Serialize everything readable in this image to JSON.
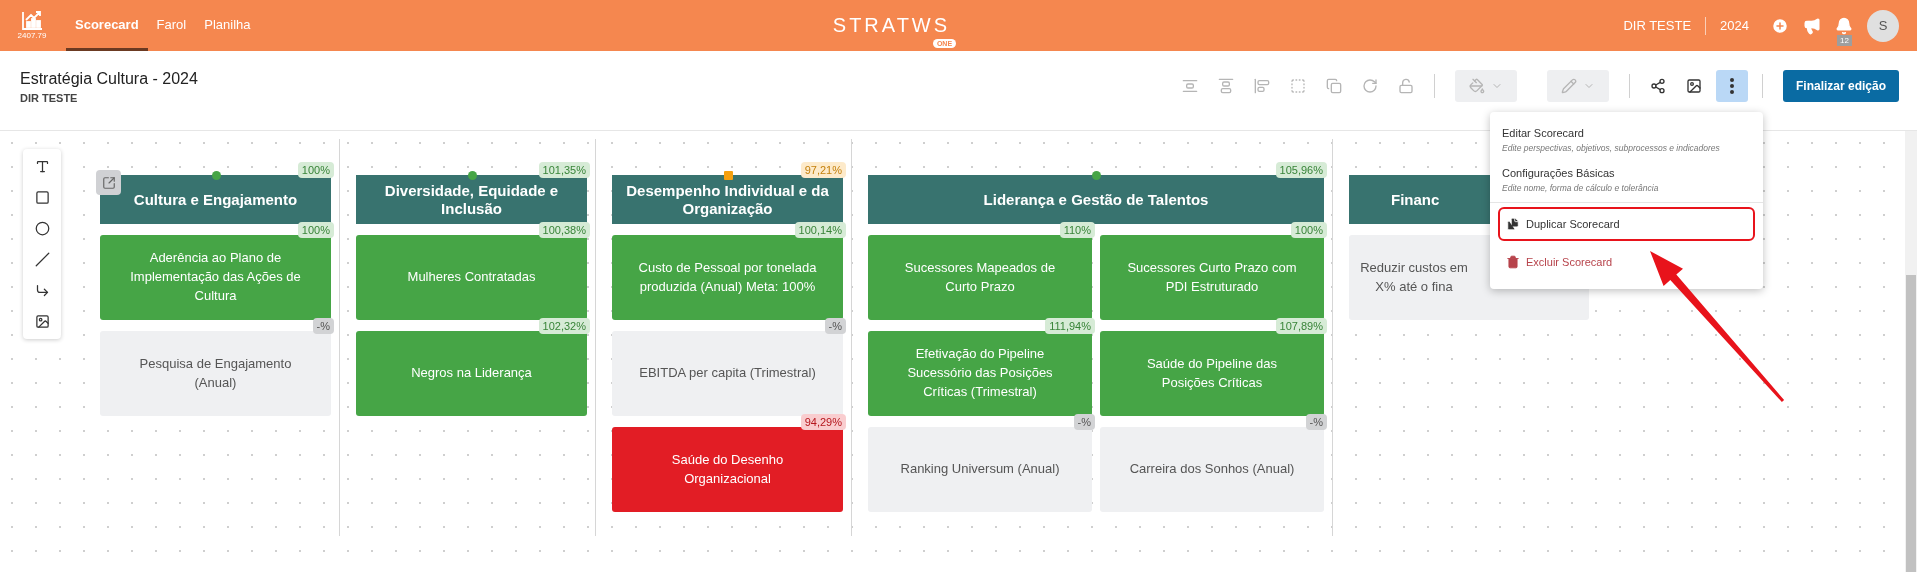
{
  "topbar": {
    "version": "2407.79",
    "tabs": [
      {
        "label": "Scorecard",
        "selected": true
      },
      {
        "label": "Farol",
        "selected": false
      },
      {
        "label": "Planilha",
        "selected": false
      }
    ],
    "logo": "STRATWS",
    "logo_badge": "ONE",
    "unit": "DIR TESTE",
    "year": "2024",
    "notifications": "12",
    "avatar": "S"
  },
  "page": {
    "title": "Estratégia Cultura - 2024",
    "subtitle": "DIR TESTE",
    "align_tools": {
      "disabled": true
    },
    "more_button": {
      "selected": true
    },
    "finish_button": "Finalizar edição"
  },
  "menu": {
    "items": [
      {
        "kind": "option",
        "label": "Editar Scorecard",
        "description": "Edite perspectivas, objetivos, subprocessos e indicadores",
        "highlighted": false
      },
      {
        "kind": "option",
        "label": "Configurações Básicas",
        "description": "Edite nome, forma de cálculo e tolerância",
        "highlighted": false
      },
      {
        "kind": "copy",
        "label": "Duplicar Scorecard",
        "highlighted": true
      },
      {
        "kind": "delete",
        "label": "Excluir Scorecard",
        "highlighted": false
      }
    ]
  },
  "perspectives": [
    {
      "kind": "single",
      "title": "Cultura e Engajamento",
      "badge": "100%",
      "marker": {
        "kind": "circle"
      },
      "color": "#46a546",
      "indicators": [
        {
          "name": "Aderência ao Plano de Implementação das Ações de Cultura",
          "badge": "100%",
          "color": "#46a546"
        },
        {
          "name": "Pesquisa de Engajamento (Anual)",
          "badge": "-%",
          "color": "#eff0f2"
        }
      ]
    },
    {
      "kind": "single",
      "title": "Diversidade, Equidade e Inclusão",
      "badge": "101,35%",
      "marker": {
        "kind": "circle"
      },
      "color": "#46a546",
      "indicators": [
        {
          "name": "Mulheres Contratadas",
          "badge": "100,38%",
          "color": "#46a546"
        },
        {
          "name": "Negros na Liderança",
          "badge": "102,32%",
          "color": "#46a546"
        }
      ]
    },
    {
      "kind": "single",
      "title": "Desempenho Individual e da Organização",
      "badge": "97,21%",
      "marker": {
        "kind": "square"
      },
      "color": "#f5a00f",
      "indicators": [
        {
          "name": "Custo de Pessoal por tonelada produzida (Anual) Meta: 100%",
          "badge": "100,14%",
          "color": "#46a546"
        },
        {
          "name": "EBITDA per capita (Trimestral)",
          "badge": "-%",
          "color": "#eff0f2"
        },
        {
          "name": "Saúde do Desenho Organizacional",
          "badge": "94,29%",
          "color": "#e21d25"
        }
      ]
    },
    {
      "kind": "double",
      "title": "Liderança e Gestão de Talentos",
      "badge": "105,96%",
      "marker": {
        "kind": "circle"
      },
      "color": "#46a546",
      "indicators": [
        {
          "name": "Sucessores Mapeados de Curto Prazo",
          "badge": "110%",
          "color": "#46a546"
        },
        {
          "name": "Sucessores Curto Prazo com PDI Estruturado",
          "badge": "100%",
          "color": "#46a546"
        },
        {
          "name": "Efetivação do Pipeline Sucessório das Posições Críticas (Trimestral)",
          "badge": "111,94%",
          "color": "#46a546"
        },
        {
          "name": "Saúde do Pipeline das Posições Críticas",
          "badge": "107,89%",
          "color": "#46a546"
        },
        {
          "name": "Ranking Universum (Anual)",
          "badge": "-%",
          "color": "#eff0f2"
        },
        {
          "name": "Carreira dos Sonhos (Anual)",
          "badge": "-%",
          "color": "#eff0f2"
        }
      ]
    },
    {
      "kind": "partial",
      "title": "Financ",
      "indicators": [
        {
          "name": "Reduzir custos em X% até o fina",
          "color": "#eff0f2"
        }
      ]
    }
  ]
}
